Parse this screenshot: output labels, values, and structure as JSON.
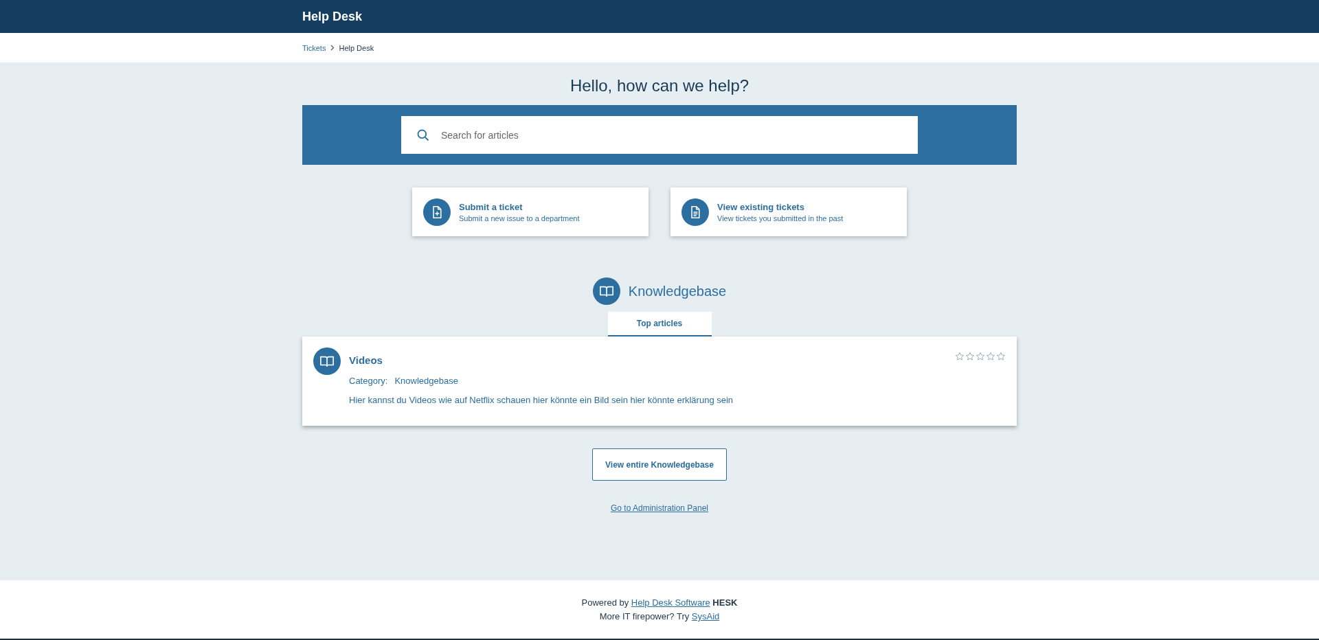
{
  "header": {
    "title": "Help Desk"
  },
  "breadcrumb": [
    {
      "label": "Tickets",
      "link": true
    },
    {
      "label": "Help Desk",
      "link": false
    }
  ],
  "hero": {
    "title": "Hello, how can we help?",
    "search": {
      "placeholder": "Search for articles"
    }
  },
  "actions": [
    {
      "kind": "submit",
      "title": "Submit a ticket",
      "subtitle": "Submit a new issue to a department"
    },
    {
      "kind": "view",
      "title": "View existing tickets",
      "subtitle": "View tickets you submitted in the past"
    }
  ],
  "knowledgebase": {
    "title": "Knowledgebase",
    "tabs": [
      {
        "label": "Top articles",
        "selected": true
      }
    ],
    "articles": [
      {
        "title": "Videos",
        "category_label": "Category:",
        "category": "Knowledgebase",
        "preview": "Hier kannst du Videos wie auf Netflix schauen hier könnte ein Bild sein hier könnte erklärung sein",
        "stars": 0
      }
    ],
    "view_all": "View entire Knowledgebase",
    "admin_link": "Go to Administration Panel"
  },
  "footer": [
    {
      "prefix": "Powered by ",
      "link": "Help Desk Software",
      "suffix": "HESK"
    },
    {
      "prefix": "More IT firepower? Try ",
      "link": "SysAid"
    }
  ]
}
